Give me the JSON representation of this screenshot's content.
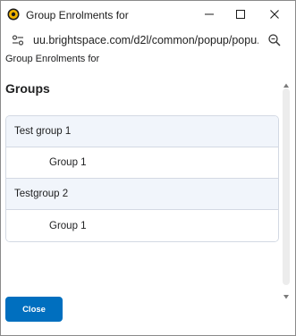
{
  "window": {
    "title": "Group Enrolments for"
  },
  "addressbar": {
    "url": "uu.brightspace.com/d2l/common/popup/popu..."
  },
  "page": {
    "heading": "Group Enrolments for",
    "section_title": "Groups",
    "groups": [
      {
        "name": "Test group 1",
        "members": [
          "Group 1"
        ]
      },
      {
        "name": "Testgroup 2",
        "members": [
          "Group 1"
        ]
      }
    ],
    "close_label": "Close"
  },
  "colors": {
    "primary_button": "#006fbf",
    "row_highlight": "#f1f5fb",
    "border": "#d3d9e3"
  }
}
